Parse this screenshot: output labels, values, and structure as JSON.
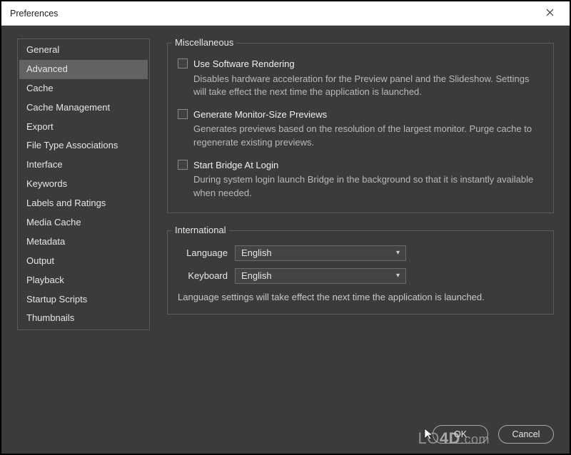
{
  "window": {
    "title": "Preferences"
  },
  "sidebar": {
    "selected": 1,
    "items": [
      "General",
      "Advanced",
      "Cache",
      "Cache Management",
      "Export",
      "File Type Associations",
      "Interface",
      "Keywords",
      "Labels and Ratings",
      "Media Cache",
      "Metadata",
      "Output",
      "Playback",
      "Startup Scripts",
      "Thumbnails"
    ]
  },
  "groups": {
    "misc": {
      "label": "Miscellaneous",
      "options": [
        {
          "label": "Use Software Rendering",
          "desc": "Disables hardware acceleration for the Preview panel and the Slideshow. Settings will take effect the next time the application is launched.",
          "checked": false
        },
        {
          "label": "Generate Monitor-Size Previews",
          "desc": "Generates previews based on the resolution of the largest monitor. Purge cache to regenerate existing previews.",
          "checked": false
        },
        {
          "label": "Start Bridge At Login",
          "desc": "During system login launch Bridge in the background so that it is instantly available when needed.",
          "checked": false
        }
      ]
    },
    "intl": {
      "label": "International",
      "language": {
        "label": "Language",
        "value": "English"
      },
      "keyboard": {
        "label": "Keyboard",
        "value": "English"
      },
      "note": "Language settings will take effect the next time the application is launched."
    }
  },
  "buttons": {
    "ok": "OK",
    "cancel": "Cancel"
  },
  "watermark": {
    "a": "LO",
    "b": "4D",
    "c": ".com"
  }
}
